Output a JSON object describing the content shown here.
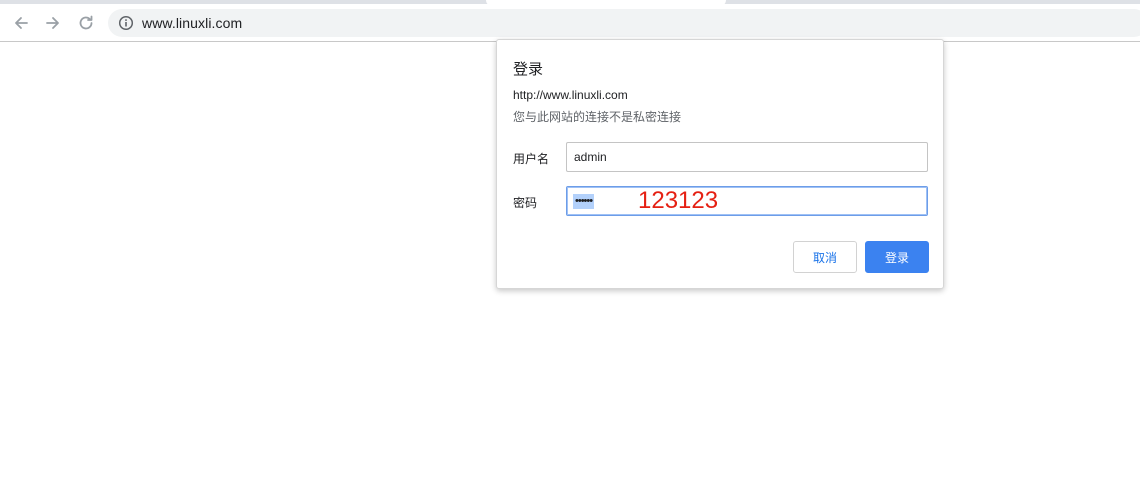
{
  "browser": {
    "url": "www.linuxli.com"
  },
  "dialog": {
    "title": "登录",
    "origin": "http://www.linuxli.com",
    "warning": "您与此网站的连接不是私密连接",
    "username_label": "用户名",
    "username_value": "admin",
    "password_label": "密码",
    "password_masked": "••••••",
    "password_annotation": "123123",
    "cancel_label": "取消",
    "login_label": "登录"
  },
  "colors": {
    "primary_button": "#3b82f0",
    "annotation": "#e52013",
    "link_text": "#1a73e8"
  },
  "icons": {
    "back": "arrow-left-icon",
    "forward": "arrow-right-icon",
    "reload": "reload-icon",
    "site_info": "info-icon"
  }
}
